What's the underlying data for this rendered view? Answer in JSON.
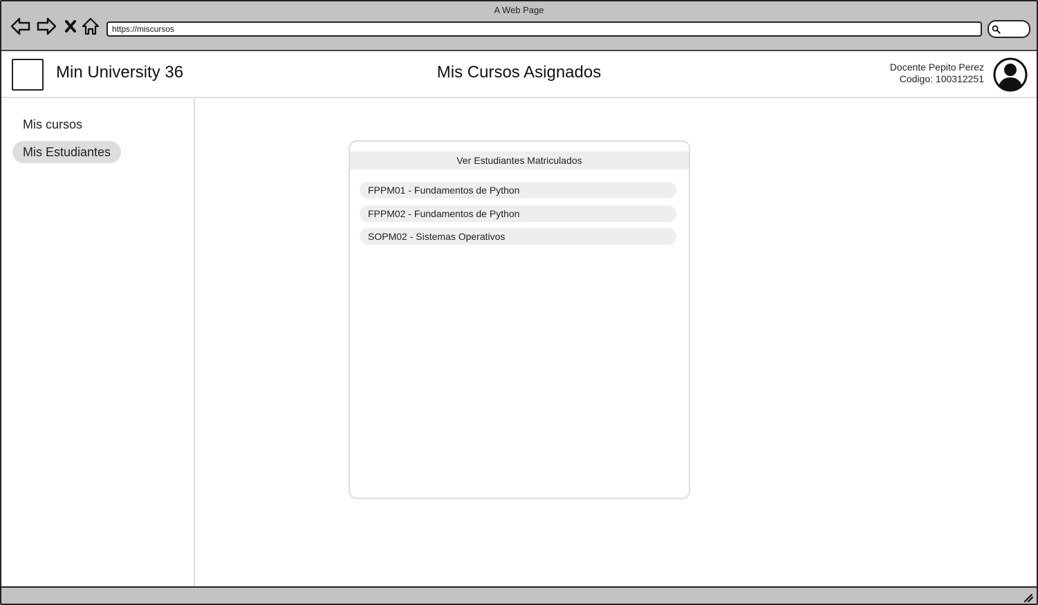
{
  "browser": {
    "window_title": "A Web Page",
    "url": "https://miscursos"
  },
  "header": {
    "brand": "Min University 36",
    "title": "Mis Cursos Asignados",
    "user_name": "Docente Pepito Perez",
    "user_code": "Codigo: 100312251"
  },
  "sidebar": {
    "items": [
      {
        "label": "Mis cursos",
        "active": false
      },
      {
        "label": "Mis Estudiantes",
        "active": true
      }
    ]
  },
  "panel": {
    "header": "Ver Estudiantes Matriculados",
    "courses": [
      {
        "label": "FPPM01 - Fundamentos de Python"
      },
      {
        "label": "FPPM02 - Fundamentos de Python"
      },
      {
        "label": "SOPM02 - Sistemas Operativos"
      }
    ]
  },
  "colors": {
    "chrome": "#c3c3c3",
    "active_item": "#dddddd",
    "list_item": "#eeeeee"
  },
  "icons": [
    "back-arrow-icon",
    "forward-arrow-icon",
    "close-icon",
    "home-icon",
    "search-icon",
    "user-avatar-icon",
    "resize-grip-icon"
  ]
}
